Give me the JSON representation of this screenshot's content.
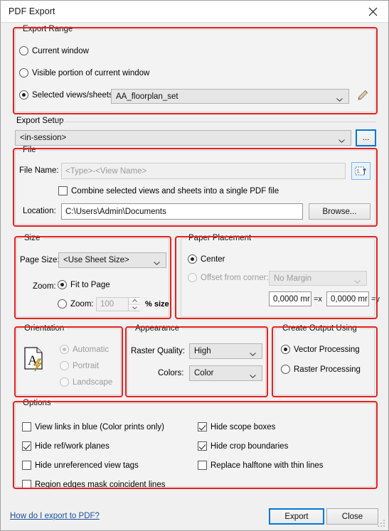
{
  "window": {
    "title": "PDF Export",
    "close_icon": "close-icon"
  },
  "export_range": {
    "legend": "Export Range",
    "options": [
      {
        "label": "Current window",
        "selected": false
      },
      {
        "label": "Visible portion of current window",
        "selected": false
      },
      {
        "label": "Selected views/sheets",
        "selected": true
      }
    ],
    "views_combo_value": "AA_floorplan_set",
    "edit_icon": "pencil-icon"
  },
  "export_setup": {
    "legend": "Export Setup",
    "combo_value": "<in-session>",
    "more_button_label": "..."
  },
  "file": {
    "legend": "File",
    "file_name_label": "File Name:",
    "file_name_placeholder": "<Type>-<View Name>",
    "file_name_value": "",
    "name_rule_icon": "name-rule-icon",
    "combine_label": "Combine selected views and sheets into a single PDF file",
    "combine_checked": false,
    "location_label": "Location:",
    "location_value": "C:\\Users\\Admin\\Documents",
    "browse_label": "Browse..."
  },
  "size": {
    "legend": "Size",
    "page_size_label": "Page Size:",
    "page_size_value": "<Use Sheet Size>",
    "zoom_label": "Zoom:",
    "fit_to_page_label": "Fit to Page",
    "fit_to_page_selected": true,
    "zoom_radio_label": "Zoom:",
    "zoom_radio_selected": false,
    "zoom_value": "100",
    "percent_label": "% size"
  },
  "paper_placement": {
    "legend": "Paper Placement",
    "center_label": "Center",
    "center_selected": true,
    "offset_label": "Offset from corner:",
    "offset_selected": false,
    "margin_value": "No Margin",
    "offset_x_value": "0,0000 mr",
    "offset_x_suffix": "=x",
    "offset_y_value": "0,0000 mr",
    "offset_y_suffix": "=y"
  },
  "orientation": {
    "legend": "Orientation",
    "icon": "page-orientation-icon",
    "options": [
      {
        "label": "Automatic",
        "selected": true
      },
      {
        "label": "Portrait",
        "selected": false
      },
      {
        "label": "Landscape",
        "selected": false
      }
    ]
  },
  "appearance": {
    "legend": "Appearance",
    "raster_quality_label": "Raster Quality:",
    "raster_quality_value": "High",
    "colors_label": "Colors:",
    "colors_value": "Color"
  },
  "create_output": {
    "legend": "Create Output Using",
    "options": [
      {
        "label": "Vector Processing",
        "selected": true
      },
      {
        "label": "Raster Processing",
        "selected": false
      }
    ]
  },
  "options": {
    "legend": "Options",
    "left_column": [
      {
        "label": "View links in blue (Color prints only)",
        "checked": false
      },
      {
        "label": "Hide ref/work planes",
        "checked": true
      },
      {
        "label": "Hide unreferenced view tags",
        "checked": false
      },
      {
        "label": "Region edges mask coincident lines",
        "checked": false
      }
    ],
    "right_column": [
      {
        "label": "Hide scope boxes",
        "checked": true
      },
      {
        "label": "Hide crop boundaries",
        "checked": true
      },
      {
        "label": "Replace halftone with thin lines",
        "checked": false
      }
    ]
  },
  "footer": {
    "help_link": "How do I export to PDF?",
    "export_label": "Export",
    "close_label": "Close"
  },
  "colors": {
    "annotation_red": "#e8201f",
    "focus_blue": "#0078d7",
    "link_blue": "#1a4f9c",
    "dialog_bg": "#f0f0f0"
  }
}
